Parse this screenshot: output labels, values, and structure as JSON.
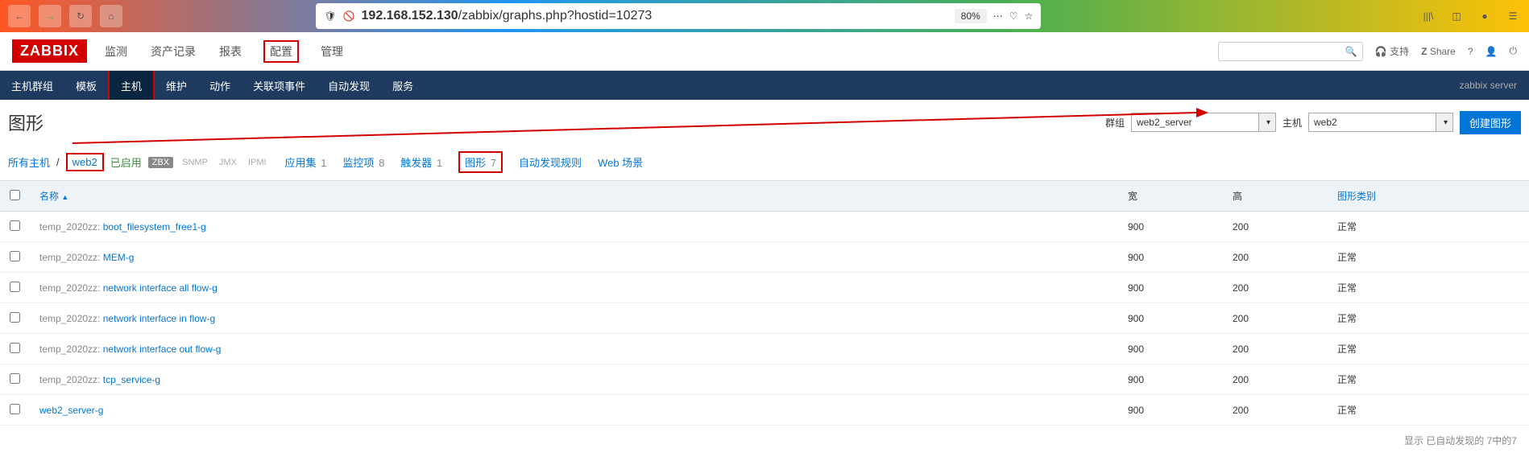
{
  "browser": {
    "url_prefix": "192.168.152.130",
    "url_path": "/zabbix/graphs.php?hostid=10273",
    "zoom": "80%"
  },
  "logo": "ZABBIX",
  "main_menu": [
    "监测",
    "资产记录",
    "报表",
    "配置",
    "管理"
  ],
  "main_menu_boxed_index": 3,
  "header_right": {
    "support": "支持",
    "share": "Share"
  },
  "sub_menu": [
    "主机群组",
    "模板",
    "主机",
    "维护",
    "动作",
    "关联项事件",
    "自动发现",
    "服务"
  ],
  "sub_menu_active_index": 2,
  "sub_menu_right": "zabbix server",
  "page_title": "图形",
  "controls": {
    "group_label": "群组",
    "group_value": "web2_server",
    "host_label": "主机",
    "host_value": "web2",
    "create_button": "创建图形"
  },
  "filter_bar": {
    "all_hosts": "所有主机",
    "host": "web2",
    "enabled": "已启用",
    "zbx": "ZBX",
    "snmp": "SNMP",
    "jmx": "JMX",
    "ipmi": "IPMI",
    "items": [
      {
        "label": "应用集",
        "count": "1"
      },
      {
        "label": "监控项",
        "count": "8"
      },
      {
        "label": "触发器",
        "count": "1"
      },
      {
        "label": "图形",
        "count": "7",
        "boxed": true
      },
      {
        "label": "自动发现规则",
        "count": ""
      },
      {
        "label": "Web 场景",
        "count": ""
      }
    ]
  },
  "table": {
    "headers": {
      "name": "名称",
      "width": "宽",
      "height": "高",
      "type": "图形类别"
    },
    "rows": [
      {
        "prefix": "temp_2020zz:",
        "name": "boot_filesystem_free1-g",
        "width": "900",
        "height": "200",
        "type": "正常"
      },
      {
        "prefix": "temp_2020zz:",
        "name": "MEM-g",
        "width": "900",
        "height": "200",
        "type": "正常"
      },
      {
        "prefix": "temp_2020zz:",
        "name": "network interface all flow-g",
        "width": "900",
        "height": "200",
        "type": "正常"
      },
      {
        "prefix": "temp_2020zz:",
        "name": "network interface in flow-g",
        "width": "900",
        "height": "200",
        "type": "正常"
      },
      {
        "prefix": "temp_2020zz:",
        "name": "network interface out flow-g",
        "width": "900",
        "height": "200",
        "type": "正常"
      },
      {
        "prefix": "temp_2020zz:",
        "name": "tcp_service-g",
        "width": "900",
        "height": "200",
        "type": "正常"
      },
      {
        "prefix": "",
        "name": "web2_server-g",
        "width": "900",
        "height": "200",
        "type": "正常"
      }
    ]
  },
  "footer": "显示 已自动发现的 7中的7"
}
